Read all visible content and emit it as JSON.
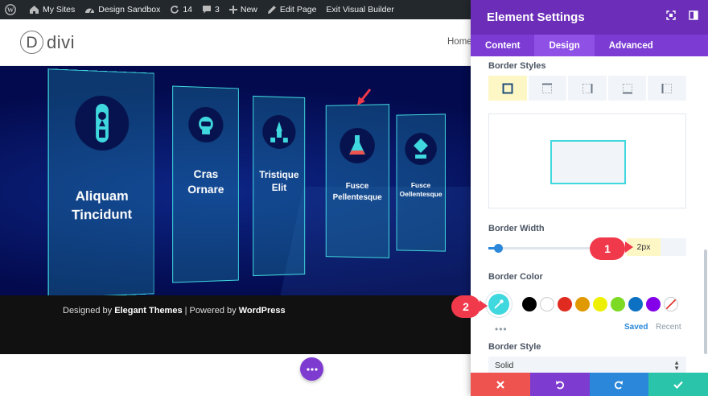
{
  "admin_bar": {
    "my_sites": "My Sites",
    "site_name": "Design Sandbox",
    "updates_count": "14",
    "comments_count": "3",
    "new_label": "New",
    "edit_page": "Edit Page",
    "exit_builder": "Exit Visual Builder"
  },
  "header": {
    "logo_letter": "D",
    "logo_text": "divi",
    "nav_home": "Home"
  },
  "cards": [
    {
      "lines": [
        "Aliquam",
        "Tincidunt"
      ],
      "icon": "rocket-icon"
    },
    {
      "lines": [
        "Cras",
        "Ornare"
      ],
      "icon": "helmet-icon"
    },
    {
      "lines": [
        "Tristique",
        "Elit"
      ],
      "icon": "launch-icon"
    },
    {
      "lines": [
        "Fusce",
        "Pellentesque"
      ],
      "icon": "flask-icon"
    },
    {
      "lines": [
        "Fusce",
        "Oellentesque"
      ],
      "icon": "crystal-icon"
    }
  ],
  "footer": {
    "prefix": "Designed by ",
    "brand1": "Elegant Themes",
    "mid": " | Powered by ",
    "brand2": "WordPress"
  },
  "panel": {
    "title": "Element Settings",
    "tabs": [
      "Content",
      "Design",
      "Advanced"
    ],
    "active_tab": "Design",
    "border_styles_label": "Border Styles",
    "border_width_label": "Border Width",
    "border_width_value": "2px",
    "slider_level": 0.08,
    "border_color_label": "Border Color",
    "swatches": [
      "#000000",
      "#ffffff",
      "#e02b20",
      "#e09900",
      "#edf000",
      "#7cda24",
      "#0c71c3",
      "#8300e9"
    ],
    "picker_color": "#3fd8df",
    "saved_label": "Saved",
    "recent_label": "Recent",
    "more_label": "•••",
    "border_style_label": "Border Style",
    "border_style_value": "Solid"
  },
  "annotations": {
    "badge1": "1",
    "badge2": "2"
  },
  "colors": {
    "purple_header": "#6c2eb9",
    "purple_tabs": "#7c3cd4",
    "accent_cyan": "#3fd8df",
    "badge_red": "#f0394b",
    "footer_red": "#ef5350",
    "footer_purple": "#7e3bd0",
    "footer_blue": "#2b87da",
    "footer_green": "#29c4a9"
  }
}
